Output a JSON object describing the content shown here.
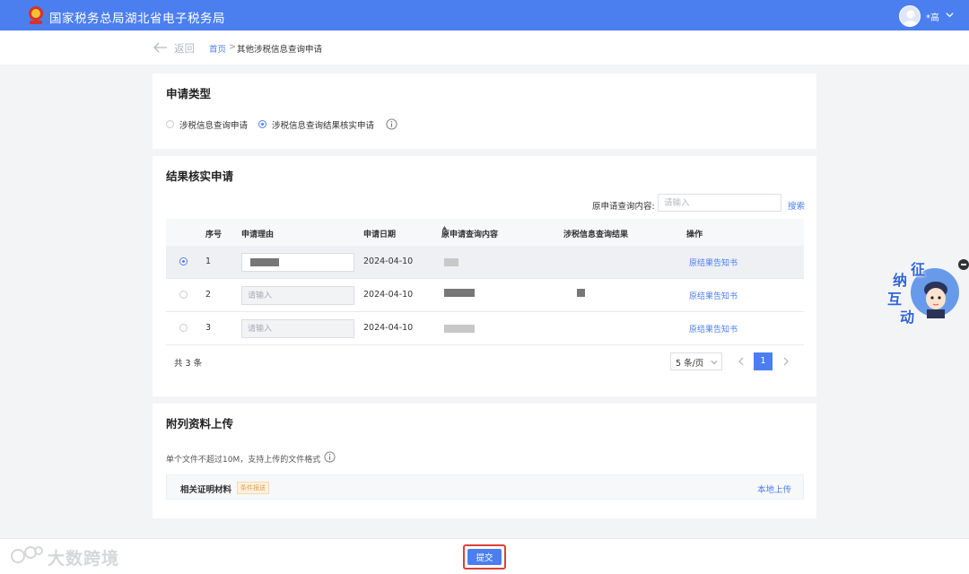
{
  "header": {
    "site_title": "国家税务总局湖北省电子税务局",
    "user_name": "*高"
  },
  "breadcrumb": {
    "back_label": "返回",
    "home": "首页",
    "separator": ">",
    "current": "其他涉税信息查询申请"
  },
  "application_type": {
    "title": "申请类型",
    "options": [
      {
        "label": "涉税信息查询申请",
        "selected": false
      },
      {
        "label": "涉税信息查询结果核实申请",
        "selected": true
      }
    ]
  },
  "verification": {
    "title": "结果核实申请",
    "search_label": "原申请查询内容:",
    "search_placeholder": "请输入",
    "search_button": "搜索",
    "columns": [
      "序号",
      "申请理由",
      "申请日期",
      "原申请查询内容",
      "涉税信息查询结果",
      "操作"
    ],
    "rows": [
      {
        "index": "1",
        "reason_placeholder": "",
        "date": "2024-04-10",
        "action": "原结果告知书",
        "selected": true
      },
      {
        "index": "2",
        "reason_placeholder": "请输入",
        "date": "2024-04-10",
        "action": "原结果告知书",
        "selected": false
      },
      {
        "index": "3",
        "reason_placeholder": "请输入",
        "date": "2024-04-10",
        "action": "原结果告知书",
        "selected": false
      }
    ],
    "total_text": "共 3 条",
    "page_size": "5 条/页",
    "current_page": "1"
  },
  "attachments": {
    "title": "附列资料上传",
    "hint": "单个文件不超过10M，支持上传的文件格式",
    "item_name": "相关证明材料",
    "item_badge": "条件报送",
    "upload_link": "本地上传"
  },
  "footer": {
    "submit_label": "提交",
    "watermark": "大数跨境"
  },
  "mascot": {
    "chars": [
      "征",
      "纳",
      "互",
      "动"
    ]
  },
  "colors": {
    "primary": "#4b7ff0",
    "highlight_border": "#d9423a",
    "badge_text": "#e5a146"
  }
}
